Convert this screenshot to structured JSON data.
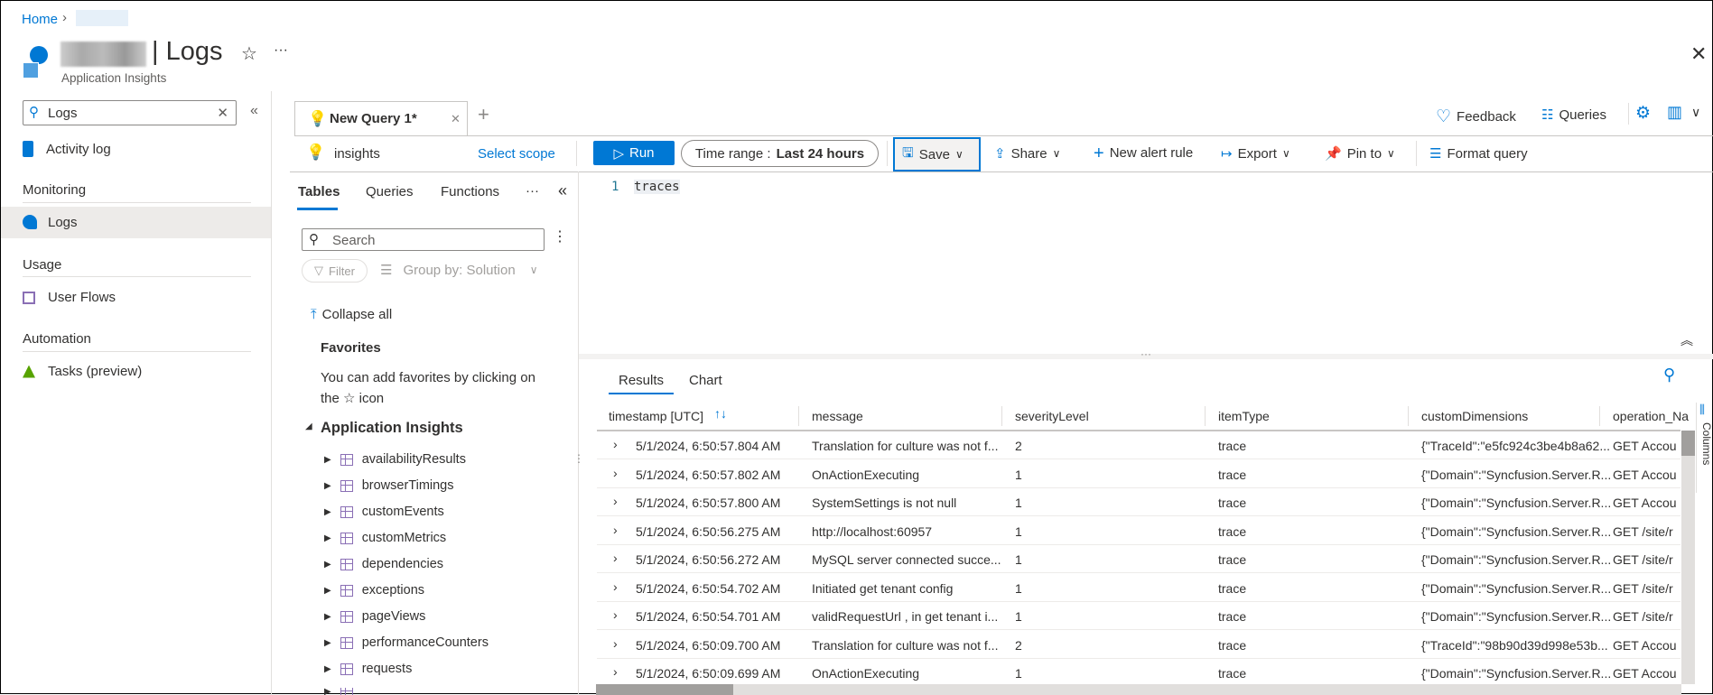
{
  "breadcrumb": {
    "home": "Home"
  },
  "header": {
    "title": "| Logs",
    "subtitle": "Application Insights"
  },
  "sidebar": {
    "search_value": "Logs",
    "items": [
      {
        "label": "Activity log"
      },
      {
        "section": "Monitoring"
      },
      {
        "label": "Logs"
      },
      {
        "section": "Usage"
      },
      {
        "label": "User Flows"
      },
      {
        "section": "Automation"
      },
      {
        "label": "Tasks (preview)"
      }
    ]
  },
  "query_tab": {
    "label": "New Query 1*"
  },
  "topbar": {
    "feedback": "Feedback",
    "queries": "Queries"
  },
  "scope": {
    "name": "insights",
    "select_scope": "Select scope"
  },
  "toolbar": {
    "run": "Run",
    "time_range_label": "Time range :",
    "time_range_value": "Last 24 hours",
    "save": "Save",
    "share": "Share",
    "new_alert": "New alert rule",
    "export": "Export",
    "pin": "Pin to",
    "format": "Format query"
  },
  "panel": {
    "tabs": [
      "Tables",
      "Queries",
      "Functions"
    ],
    "search_placeholder": "Search",
    "filter": "Filter",
    "group_by": "Group by: Solution",
    "collapse_all": "Collapse all",
    "favorites_title": "Favorites",
    "favorites_text1": "You can add favorites by clicking on",
    "favorites_text2": "the ☆ icon",
    "group": "Application Insights",
    "tables": [
      "availabilityResults",
      "browserTimings",
      "customEvents",
      "customMetrics",
      "dependencies",
      "exceptions",
      "pageViews",
      "performanceCounters",
      "requests"
    ]
  },
  "editor": {
    "line_number": "1",
    "code": "traces"
  },
  "results": {
    "tabs": [
      "Results",
      "Chart"
    ],
    "columns_label": "Columns",
    "headers": [
      "timestamp [UTC]",
      "message",
      "severityLevel",
      "itemType",
      "customDimensions",
      "operation_Na"
    ],
    "rows": [
      [
        "5/1/2024, 6:50:57.804 AM",
        "Translation for culture was not f...",
        "2",
        "trace",
        "{\"TraceId\":\"e5fc924c3be4b8a62...",
        "GET Accou"
      ],
      [
        "5/1/2024, 6:50:57.802 AM",
        "OnActionExecuting",
        "1",
        "trace",
        "{\"Domain\":\"Syncfusion.Server.R...",
        "GET Accou"
      ],
      [
        "5/1/2024, 6:50:57.800 AM",
        "SystemSettings is not null",
        "1",
        "trace",
        "{\"Domain\":\"Syncfusion.Server.R...",
        "GET Accou"
      ],
      [
        "5/1/2024, 6:50:56.275 AM",
        "http://localhost:60957",
        "1",
        "trace",
        "{\"Domain\":\"Syncfusion.Server.R...",
        "GET /site/r"
      ],
      [
        "5/1/2024, 6:50:56.272 AM",
        "MySQL server connected succe...",
        "1",
        "trace",
        "{\"Domain\":\"Syncfusion.Server.R...",
        "GET /site/r"
      ],
      [
        "5/1/2024, 6:50:54.702 AM",
        "Initiated get tenant config",
        "1",
        "trace",
        "{\"Domain\":\"Syncfusion.Server.R...",
        "GET /site/r"
      ],
      [
        "5/1/2024, 6:50:54.701 AM",
        "validRequestUrl , in get tenant i...",
        "1",
        "trace",
        "{\"Domain\":\"Syncfusion.Server.R...",
        "GET /site/r"
      ],
      [
        "5/1/2024, 6:50:09.700 AM",
        "Translation for culture was not f...",
        "2",
        "trace",
        "{\"TraceId\":\"98b90d39d998e53b...",
        "GET Accou"
      ],
      [
        "5/1/2024, 6:50:09.699 AM",
        "OnActionExecuting",
        "1",
        "trace",
        "{\"Domain\":\"Syncfusion.Server.R...",
        "GET Accou"
      ]
    ]
  },
  "colors": {
    "accent": "#0078d4",
    "lightbulb": "#8661c5"
  }
}
